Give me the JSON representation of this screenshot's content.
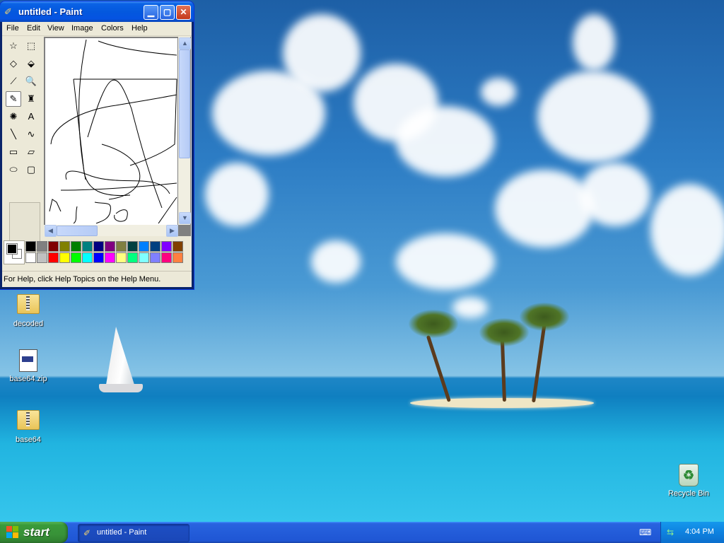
{
  "window": {
    "title": "untitled - Paint",
    "menu": [
      "File",
      "Edit",
      "View",
      "Image",
      "Colors",
      "Help"
    ],
    "status": "For Help, click Help Topics on the Help Menu."
  },
  "tools": [
    {
      "name": "free-form-select-icon",
      "glyph": "☆"
    },
    {
      "name": "select-icon",
      "glyph": "⬚"
    },
    {
      "name": "eraser-icon",
      "glyph": "◇"
    },
    {
      "name": "fill-icon",
      "glyph": "⬙"
    },
    {
      "name": "pick-color-icon",
      "glyph": "⟋"
    },
    {
      "name": "magnifier-icon",
      "glyph": "🔍"
    },
    {
      "name": "pencil-icon",
      "glyph": "✎"
    },
    {
      "name": "brush-icon",
      "glyph": "♜"
    },
    {
      "name": "airbrush-icon",
      "glyph": "✺"
    },
    {
      "name": "text-icon",
      "glyph": "A"
    },
    {
      "name": "line-icon",
      "glyph": "╲"
    },
    {
      "name": "curve-icon",
      "glyph": "∿"
    },
    {
      "name": "rectangle-icon",
      "glyph": "▭"
    },
    {
      "name": "polygon-icon",
      "glyph": "▱"
    },
    {
      "name": "ellipse-icon",
      "glyph": "⬭"
    },
    {
      "name": "rounded-rectangle-icon",
      "glyph": "▢"
    }
  ],
  "active_tool": "pencil-icon",
  "palette": {
    "top": [
      "#000000",
      "#808080",
      "#800000",
      "#808000",
      "#008000",
      "#008080",
      "#000080",
      "#800080",
      "#808040",
      "#004040",
      "#0080ff",
      "#004080",
      "#8000ff",
      "#804000"
    ],
    "bottom": [
      "#ffffff",
      "#c0c0c0",
      "#ff0000",
      "#ffff00",
      "#00ff00",
      "#00ffff",
      "#0000ff",
      "#ff00ff",
      "#ffff80",
      "#00ff80",
      "#80ffff",
      "#8080ff",
      "#ff0080",
      "#ff8040"
    ],
    "foreground": "#000000",
    "background": "#ffffff"
  },
  "desktop_icons": [
    {
      "label": "decoded",
      "type": "zip-folder-icon"
    },
    {
      "label": "base64.zip",
      "type": "file-icon"
    },
    {
      "label": "base64",
      "type": "zip-folder-icon"
    },
    {
      "label": "Recycle Bin",
      "type": "recycle-bin-icon"
    }
  ],
  "taskbar": {
    "start_label": "start",
    "task_label": "untitled - Paint",
    "clock": "4:04 PM"
  }
}
